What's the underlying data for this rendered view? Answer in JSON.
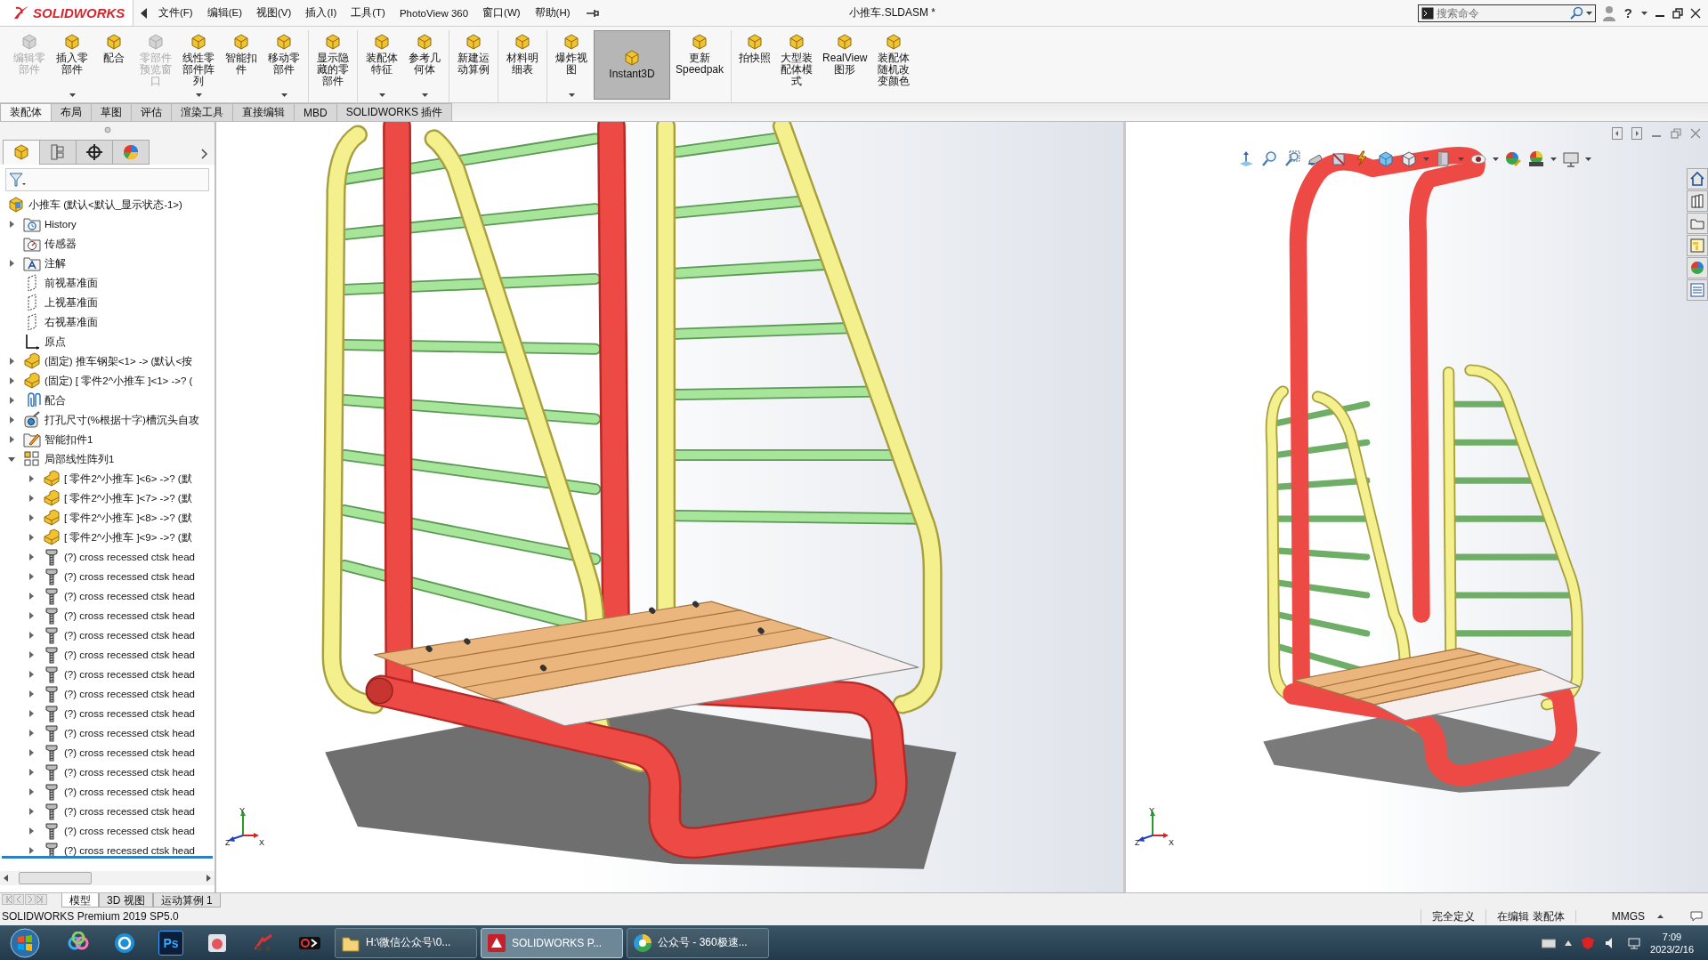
{
  "app": {
    "logo": "SOLIDWORKS",
    "menus": [
      "文件(F)",
      "编辑(E)",
      "视图(V)",
      "插入(I)",
      "工具(T)",
      "PhotoView 360",
      "窗口(W)",
      "帮助(H)"
    ],
    "title": "小推车.SLDASM *",
    "search": {
      "placeholder": "搜索命令"
    },
    "help": "?"
  },
  "ribbon": {
    "groups": [
      [
        {
          "label": "编辑零部件",
          "disabled": true,
          "dropdown": false,
          "pressed": false
        },
        {
          "label": "插入零部件",
          "disabled": false,
          "dropdown": true,
          "pressed": false
        },
        {
          "label": "配合",
          "disabled": false,
          "dropdown": false,
          "pressed": false
        },
        {
          "label": "零部件预览窗口",
          "disabled": true,
          "dropdown": false,
          "pressed": false
        },
        {
          "label": "线性零部件阵列",
          "disabled": false,
          "dropdown": true,
          "pressed": false
        },
        {
          "label": "智能扣件",
          "disabled": false,
          "dropdown": false,
          "pressed": false
        },
        {
          "label": "移动零部件",
          "disabled": false,
          "dropdown": true,
          "pressed": false
        }
      ],
      [
        {
          "label": "显示隐藏的零部件",
          "disabled": false,
          "dropdown": false,
          "pressed": false
        }
      ],
      [
        {
          "label": "装配体特征",
          "disabled": false,
          "dropdown": true,
          "pressed": false
        },
        {
          "label": "参考几何体",
          "disabled": false,
          "dropdown": true,
          "pressed": false
        }
      ],
      [
        {
          "label": "新建运动算例",
          "disabled": false,
          "dropdown": false,
          "pressed": false
        }
      ],
      [
        {
          "label": "材料明细表",
          "disabled": false,
          "dropdown": false,
          "pressed": false
        }
      ],
      [
        {
          "label": "爆炸视图",
          "disabled": false,
          "dropdown": true,
          "pressed": false
        },
        {
          "label": "Instant3D",
          "disabled": false,
          "dropdown": false,
          "pressed": true
        },
        {
          "label": "更新 Speedpak",
          "disabled": false,
          "dropdown": false,
          "pressed": false
        }
      ],
      [
        {
          "label": "拍快照",
          "disabled": false,
          "dropdown": false,
          "pressed": false
        },
        {
          "label": "大型装配体模式",
          "disabled": false,
          "dropdown": false,
          "pressed": false
        },
        {
          "label": "RealView 图形",
          "disabled": false,
          "dropdown": false,
          "pressed": false
        },
        {
          "label": "装配体随机改变颜色",
          "disabled": false,
          "dropdown": false,
          "pressed": false
        }
      ]
    ]
  },
  "command_tabs": [
    {
      "label": "装配体",
      "selected": true
    },
    {
      "label": "布局",
      "selected": false
    },
    {
      "label": "草图",
      "selected": false
    },
    {
      "label": "评估",
      "selected": false
    },
    {
      "label": "渲染工具",
      "selected": false
    },
    {
      "label": "直接编辑",
      "selected": false
    },
    {
      "label": "MBD",
      "selected": false
    },
    {
      "label": "SOLIDWORKS 插件",
      "selected": false
    }
  ],
  "feature_tree": {
    "panel_tabs": [
      {
        "selected": true
      },
      {
        "selected": false
      },
      {
        "selected": false
      },
      {
        "selected": false
      }
    ],
    "root": {
      "label": "小推车 (默认<默认_显示状态-1>)",
      "kind": "assembly",
      "children": [
        {
          "label": "History",
          "kind": "history",
          "expanded": false
        },
        {
          "label": "传感器",
          "kind": "sensor"
        },
        {
          "label": "注解",
          "kind": "annotation",
          "expanded": false
        },
        {
          "label": "前视基准面",
          "kind": "plane"
        },
        {
          "label": "上视基准面",
          "kind": "plane"
        },
        {
          "label": "右视基准面",
          "kind": "plane"
        },
        {
          "label": "原点",
          "kind": "origin"
        },
        {
          "label": "(固定) 推车钢架<1> -> (默认<按",
          "kind": "part",
          "expanded": false
        },
        {
          "label": "(固定) [ 零件2^小推车 ]<1> ->? (",
          "kind": "part",
          "expanded": false
        },
        {
          "label": "配合",
          "kind": "mate",
          "expanded": false
        },
        {
          "label": "打孔尺寸(%根据十字)槽沉头自攻",
          "kind": "hole",
          "expanded": false
        },
        {
          "label": "智能扣件1",
          "kind": "fastener",
          "expanded": false
        },
        {
          "label": "局部线性阵列1",
          "kind": "pattern",
          "expanded": true,
          "children": [
            {
              "label": "[ 零件2^小推车 ]<6> ->? (默",
              "kind": "part",
              "expanded": false
            },
            {
              "label": "[ 零件2^小推车 ]<7> ->? (默",
              "kind": "part",
              "expanded": false
            },
            {
              "label": "[ 零件2^小推车 ]<8> ->? (默",
              "kind": "part",
              "expanded": false
            },
            {
              "label": "[ 零件2^小推车 ]<9> ->? (默",
              "kind": "part",
              "expanded": false
            },
            {
              "label": "(?) cross recessed ctsk head",
              "kind": "screw",
              "expanded": false
            },
            {
              "label": "(?) cross recessed ctsk head",
              "kind": "screw",
              "expanded": false
            },
            {
              "label": "(?) cross recessed ctsk head",
              "kind": "screw",
              "expanded": false
            },
            {
              "label": "(?) cross recessed ctsk head",
              "kind": "screw",
              "expanded": false
            },
            {
              "label": "(?) cross recessed ctsk head",
              "kind": "screw",
              "expanded": false
            },
            {
              "label": "(?) cross recessed ctsk head",
              "kind": "screw",
              "expanded": false
            },
            {
              "label": "(?) cross recessed ctsk head",
              "kind": "screw",
              "expanded": false
            },
            {
              "label": "(?) cross recessed ctsk head",
              "kind": "screw",
              "expanded": false
            },
            {
              "label": "(?) cross recessed ctsk head",
              "kind": "screw",
              "expanded": false
            },
            {
              "label": "(?) cross recessed ctsk head",
              "kind": "screw",
              "expanded": false
            },
            {
              "label": "(?) cross recessed ctsk head",
              "kind": "screw",
              "expanded": false
            },
            {
              "label": "(?) cross recessed ctsk head",
              "kind": "screw",
              "expanded": false
            },
            {
              "label": "(?) cross recessed ctsk head",
              "kind": "screw",
              "expanded": false
            },
            {
              "label": "(?) cross recessed ctsk head",
              "kind": "screw",
              "expanded": false
            },
            {
              "label": "(?) cross recessed ctsk head",
              "kind": "screw",
              "expanded": false
            },
            {
              "label": "(?) cross recessed ctsk head",
              "kind": "screw",
              "expanded": false
            }
          ]
        }
      ]
    }
  },
  "viewports": [
    {
      "triad": {
        "y": "Y",
        "z": "Z",
        "x": "X"
      }
    },
    {
      "triad": {
        "y": "Y",
        "z": "Z",
        "x": "X"
      }
    }
  ],
  "bottom_tabs": [
    {
      "label": "模型",
      "selected": true
    },
    {
      "label": "3D 视图",
      "selected": false
    },
    {
      "label": "运动算例 1",
      "selected": false
    }
  ],
  "status_bar": {
    "product": "SOLIDWORKS Premium 2019 SP5.0",
    "items": [
      "完全定义",
      "在编辑 装配体",
      "MMGS"
    ]
  },
  "taskbar": {
    "pinned": [
      {
        "kind": "rings"
      },
      {
        "kind": "circle"
      },
      {
        "kind": "ps",
        "text": "Ps"
      },
      {
        "kind": "camera"
      },
      {
        "kind": "scissors"
      },
      {
        "kind": "recorder"
      }
    ],
    "tasks": [
      {
        "label": "H:\\微信公众号\\0...",
        "selected": false
      },
      {
        "label": "SOLIDWORKS P...",
        "selected": true
      },
      {
        "label": "公众号 - 360极速...",
        "selected": false
      }
    ],
    "time": "7:09",
    "date": "2023/2/16"
  }
}
